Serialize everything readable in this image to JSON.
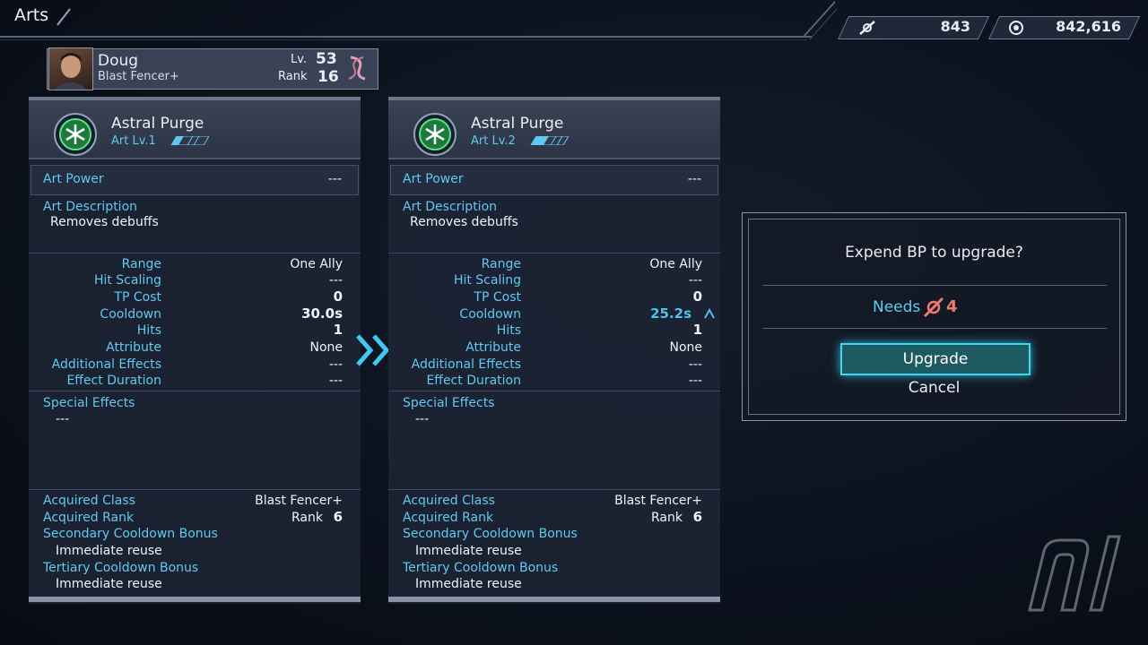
{
  "header": {
    "title": "Arts"
  },
  "resources": {
    "bp": "843",
    "credits": "842,616"
  },
  "character": {
    "name": "Doug",
    "class": "Blast Fencer+",
    "lv_label": "Lv.",
    "lv_value": "53",
    "rank_label": "Rank",
    "rank_value": "16"
  },
  "panels": [
    {
      "art_name": "Astral Purge",
      "art_level": "Art Lv.1",
      "power_label": "Art Power",
      "power_value": "---",
      "desc_label": "Art Description",
      "desc_value": "Removes debuffs",
      "stats": [
        {
          "label": "Range",
          "value": "One Ally"
        },
        {
          "label": "Hit Scaling",
          "value": "---"
        },
        {
          "label": "TP Cost",
          "value": "0"
        },
        {
          "label": "Cooldown",
          "value": "30.0s"
        },
        {
          "label": "Hits",
          "value": "1"
        },
        {
          "label": "Attribute",
          "value": "None"
        },
        {
          "label": "Additional Effects",
          "value": "---"
        },
        {
          "label": "Effect Duration",
          "value": "---"
        }
      ],
      "special_label": "Special Effects",
      "special_value": "---",
      "acq_class_label": "Acquired Class",
      "acq_class_value": "Blast Fencer+",
      "acq_rank_label": "Acquired Rank",
      "acq_rank_label2": "Rank",
      "acq_rank_value": "6",
      "sec_label": "Secondary Cooldown Bonus",
      "sec_value": "Immediate reuse",
      "ter_label": "Tertiary Cooldown Bonus",
      "ter_value": "Immediate reuse"
    },
    {
      "art_name": "Astral Purge",
      "art_level": "Art Lv.2",
      "power_label": "Art Power",
      "power_value": "---",
      "desc_label": "Art Description",
      "desc_value": "Removes debuffs",
      "stats": [
        {
          "label": "Range",
          "value": "One Ally"
        },
        {
          "label": "Hit Scaling",
          "value": "---"
        },
        {
          "label": "TP Cost",
          "value": "0"
        },
        {
          "label": "Cooldown",
          "value": "25.2s"
        },
        {
          "label": "Hits",
          "value": "1"
        },
        {
          "label": "Attribute",
          "value": "None"
        },
        {
          "label": "Additional Effects",
          "value": "---"
        },
        {
          "label": "Effect Duration",
          "value": "---"
        }
      ],
      "special_label": "Special Effects",
      "special_value": "---",
      "acq_class_label": "Acquired Class",
      "acq_class_value": "Blast Fencer+",
      "acq_rank_label": "Acquired Rank",
      "acq_rank_label2": "Rank",
      "acq_rank_value": "6",
      "sec_label": "Secondary Cooldown Bonus",
      "sec_value": "Immediate reuse",
      "ter_label": "Tertiary Cooldown Bonus",
      "ter_value": "Immediate reuse"
    }
  ],
  "dialog": {
    "question": "Expend BP to upgrade?",
    "needs_label": "Needs",
    "needs_value": "4",
    "upgrade_label": "Upgrade",
    "cancel_label": "Cancel"
  },
  "icons": {
    "bp": "bp-icon",
    "credits": "credits-icon",
    "art": "art-icon",
    "transition": "double-chevron-right-icon",
    "upgrade_arrow": "up-arrow-icon"
  },
  "colors": {
    "accent": "#61c8ee",
    "upgrade_highlight": "#40d8f0",
    "cost": "#f07a6e",
    "improved": "#5ec8f0"
  }
}
